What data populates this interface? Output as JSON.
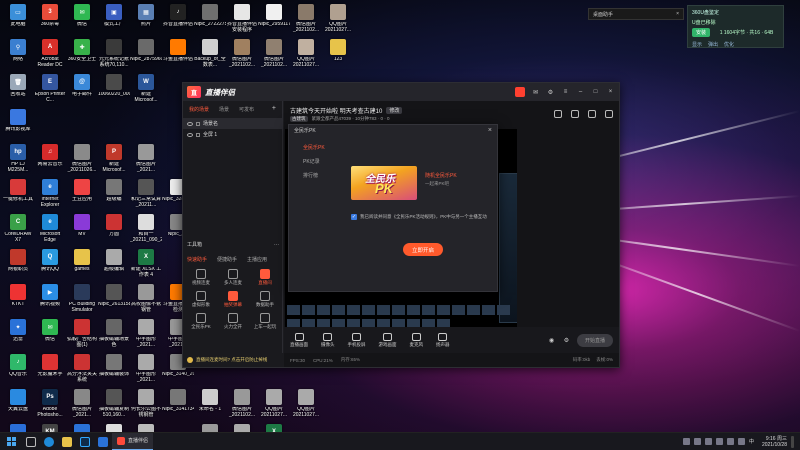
{
  "desktop_icons": [
    {
      "label": "此电脑",
      "color": "#3b8fd9",
      "glyph": "▭"
    },
    {
      "label": "360杀毒",
      "color": "#e94c3a",
      "glyph": "3"
    },
    {
      "label": "微信",
      "color": "#2fb852",
      "glyph": "✉"
    },
    {
      "label": "模式工厂",
      "color": "#3a5ec0",
      "glyph": "▣"
    },
    {
      "label": "照片",
      "color": "#5a7fb4",
      "glyph": "▦"
    },
    {
      "label": "抖音直播伴侣",
      "color": "#222",
      "glyph": "♪"
    },
    {
      "label": "Nipic_27222751_20210...",
      "color": "#6f6f6f",
      "glyph": ""
    },
    {
      "label": "抖音直播伴侣安装程序",
      "color": "#e6e6e6",
      "glyph": ""
    },
    {
      "label": "Nipic_29591172_20200...",
      "color": "#f0f0f0",
      "glyph": ""
    },
    {
      "label": "微信图片_2021102...",
      "color": "#8a7a6a",
      "glyph": ""
    },
    {
      "label": "QQ图片20211027...",
      "color": "#b0a090",
      "glyph": ""
    },
    {
      "label": "网络",
      "color": "#3b7fd0",
      "glyph": "⚲"
    },
    {
      "label": "Acrobat Reader DC",
      "color": "#d9302a",
      "glyph": "A"
    },
    {
      "label": "360安全卫士",
      "color": "#38b24a",
      "glyph": "✚"
    },
    {
      "label": "元元系统记账系统70,110...",
      "color": "#3a3a3a",
      "glyph": ""
    },
    {
      "label": "Nipic_28759601_20210...",
      "color": "#6a6a6a",
      "glyph": ""
    },
    {
      "label": "斗鱼直播伴侣",
      "color": "#ff7a00",
      "glyph": ""
    },
    {
      "label": "Backup_of_全数表...",
      "color": "#cfcfcf",
      "glyph": ""
    },
    {
      "label": "微信图片_2021102...",
      "color": "#a08060",
      "glyph": ""
    },
    {
      "label": "微信图片_2021102...",
      "color": "#908070",
      "glyph": ""
    },
    {
      "label": "QQ图片20211027...",
      "color": "#c0b0a0",
      "glyph": ""
    },
    {
      "label": "123",
      "color": "#e7c34a",
      "glyph": ""
    },
    {
      "label": "回收站",
      "color": "#9aa8b8",
      "glyph": "🗑"
    },
    {
      "label": "Epson Printer C...",
      "color": "#3456a0",
      "glyph": "E"
    },
    {
      "label": "电子邮件",
      "color": "#3a88d8",
      "glyph": "@"
    },
    {
      "label": "10060220_0005780884",
      "color": "#4a4a4a",
      "glyph": ""
    },
    {
      "label": "新建 Microsof...",
      "color": "#2b579a",
      "glyph": "W"
    },
    {
      "label": "",
      "color": "",
      "glyph": ""
    },
    {
      "label": "",
      "color": "",
      "glyph": ""
    },
    {
      "label": "",
      "color": "",
      "glyph": ""
    },
    {
      "label": "",
      "color": "",
      "glyph": ""
    },
    {
      "label": "",
      "color": "",
      "glyph": ""
    },
    {
      "label": "",
      "color": "",
      "glyph": ""
    },
    {
      "label": "腾讯影视库",
      "color": "#3a78e0",
      "glyph": ""
    },
    {
      "label": "",
      "color": "",
      "glyph": ""
    },
    {
      "label": "",
      "color": "",
      "glyph": ""
    },
    {
      "label": "",
      "color": "",
      "glyph": ""
    },
    {
      "label": "",
      "color": "",
      "glyph": ""
    },
    {
      "label": "",
      "color": "",
      "glyph": ""
    },
    {
      "label": "",
      "color": "",
      "glyph": ""
    },
    {
      "label": "",
      "color": "",
      "glyph": ""
    },
    {
      "label": "",
      "color": "",
      "glyph": ""
    },
    {
      "label": "",
      "color": "",
      "glyph": ""
    },
    {
      "label": "",
      "color": "",
      "glyph": ""
    },
    {
      "label": "HP LJ M225M...",
      "color": "#2a5ea8",
      "glyph": "hp"
    },
    {
      "label": "网易云音乐",
      "color": "#d62b2b",
      "glyph": "♫"
    },
    {
      "label": "微信图片_20211026...",
      "color": "#8a8a8a",
      "glyph": ""
    },
    {
      "label": "新建 Microsof...",
      "color": "#c0392b",
      "glyph": "P"
    },
    {
      "label": "微信图片_2021...",
      "color": "#999",
      "glyph": ""
    },
    {
      "label": "",
      "color": "",
      "glyph": ""
    },
    {
      "label": "",
      "color": "",
      "glyph": ""
    },
    {
      "label": "",
      "color": "",
      "glyph": ""
    },
    {
      "label": "",
      "color": "",
      "glyph": ""
    },
    {
      "label": "",
      "color": "",
      "glyph": ""
    },
    {
      "label": "",
      "color": "",
      "glyph": ""
    },
    {
      "label": "一键修机工具",
      "color": "#d83a3a",
      "glyph": ""
    },
    {
      "label": "Internet Explorer",
      "color": "#2f7fd8",
      "glyph": "e"
    },
    {
      "label": "土豆应用",
      "color": "#e44",
      "glyph": ""
    },
    {
      "label": "超级编",
      "color": "#777",
      "glyph": ""
    },
    {
      "label": "和记三常试算_20211...",
      "color": "#555",
      "glyph": ""
    },
    {
      "label": "Nipic_32846_202...",
      "color": "#eee",
      "glyph": ""
    },
    {
      "label": "",
      "color": "",
      "glyph": ""
    },
    {
      "label": "",
      "color": "",
      "glyph": ""
    },
    {
      "label": "",
      "color": "",
      "glyph": ""
    },
    {
      "label": "",
      "color": "",
      "glyph": ""
    },
    {
      "label": "",
      "color": "",
      "glyph": ""
    },
    {
      "label": "CorelDRAW X7",
      "color": "#3aa048",
      "glyph": "C"
    },
    {
      "label": "Microsoft Edge",
      "color": "#1f8ad8",
      "glyph": "e"
    },
    {
      "label": "MV",
      "color": "#8a3ad8",
      "glyph": ""
    },
    {
      "label": "方圆",
      "color": "#c33",
      "glyph": ""
    },
    {
      "label": "和目一_20211_090_20210...",
      "color": "#ddd",
      "glyph": ""
    },
    {
      "label": "Nipic_2...",
      "color": "#888",
      "glyph": ""
    },
    {
      "label": "",
      "color": "",
      "glyph": ""
    },
    {
      "label": "",
      "color": "",
      "glyph": ""
    },
    {
      "label": "",
      "color": "",
      "glyph": ""
    },
    {
      "label": "",
      "color": "",
      "glyph": ""
    },
    {
      "label": "",
      "color": "",
      "glyph": ""
    },
    {
      "label": "网银职员",
      "color": "#c0392b",
      "glyph": ""
    },
    {
      "label": "腾讯QQ",
      "color": "#2a9ae0",
      "glyph": "Q"
    },
    {
      "label": "games",
      "color": "#e7c34a",
      "glyph": ""
    },
    {
      "label": "超级编辑",
      "color": "#aaa",
      "glyph": ""
    },
    {
      "label": "新建 XLSX 工作表 4",
      "color": "#1d7a45",
      "glyph": "X"
    },
    {
      "label": "",
      "color": "",
      "glyph": ""
    },
    {
      "label": "",
      "color": "",
      "glyph": ""
    },
    {
      "label": "",
      "color": "",
      "glyph": ""
    },
    {
      "label": "",
      "color": "",
      "glyph": ""
    },
    {
      "label": "",
      "color": "",
      "glyph": ""
    },
    {
      "label": "",
      "color": "",
      "glyph": ""
    },
    {
      "label": "KTKT",
      "color": "#e33",
      "glyph": ""
    },
    {
      "label": "腾讯视频",
      "color": "#2b8ee6",
      "glyph": "▶"
    },
    {
      "label": "PC Building Simulator",
      "color": "#2a3a5a",
      "glyph": ""
    },
    {
      "label": "Nipic_26131580_20191...",
      "color": "#555",
      "glyph": ""
    },
    {
      "label": "高校图像不锈钢管",
      "color": "#999",
      "glyph": ""
    },
    {
      "label": "斗鱼直播安全检测",
      "color": "#ff7a00",
      "glyph": ""
    },
    {
      "label": "",
      "color": "",
      "glyph": ""
    },
    {
      "label": "",
      "color": "",
      "glyph": ""
    },
    {
      "label": "",
      "color": "",
      "glyph": ""
    },
    {
      "label": "",
      "color": "",
      "glyph": ""
    },
    {
      "label": "",
      "color": "",
      "glyph": ""
    },
    {
      "label": "迅雷",
      "color": "#2a72d8",
      "glyph": "✦"
    },
    {
      "label": "微信",
      "color": "#2fb852",
      "glyph": "✉"
    },
    {
      "label": "弘毅广告结构图(1)",
      "color": "#c33",
      "glyph": ""
    },
    {
      "label": "抽板磁辅场景色",
      "color": "#666",
      "glyph": ""
    },
    {
      "label": "中宇图形_2021...",
      "color": "#aaa",
      "glyph": ""
    },
    {
      "label": "中宇图形_2021...",
      "color": "#999",
      "glyph": ""
    },
    {
      "label": "",
      "color": "",
      "glyph": ""
    },
    {
      "label": "",
      "color": "",
      "glyph": ""
    },
    {
      "label": "",
      "color": "",
      "glyph": ""
    },
    {
      "label": "",
      "color": "",
      "glyph": ""
    },
    {
      "label": "",
      "color": "",
      "glyph": ""
    },
    {
      "label": "QQ音乐",
      "color": "#2fb86a",
      "glyph": "♪"
    },
    {
      "label": "光影魔术手",
      "color": "#d33",
      "glyph": ""
    },
    {
      "label": "高分浮法夹关系统",
      "color": "#c33",
      "glyph": ""
    },
    {
      "label": "抽板磁辅装饰",
      "color": "#777",
      "glyph": ""
    },
    {
      "label": "中宇图形_2021...",
      "color": "#aaa",
      "glyph": ""
    },
    {
      "label": "Nipic_3140_2021...",
      "color": "#888",
      "glyph": ""
    },
    {
      "label": "",
      "color": "",
      "glyph": ""
    },
    {
      "label": "",
      "color": "",
      "glyph": ""
    },
    {
      "label": "",
      "color": "",
      "glyph": ""
    },
    {
      "label": "",
      "color": "",
      "glyph": ""
    },
    {
      "label": "",
      "color": "",
      "glyph": ""
    },
    {
      "label": "天翼云盘",
      "color": "#2a8ae0",
      "glyph": ""
    },
    {
      "label": "Adobe Photosho...",
      "color": "#0f2b4a",
      "glyph": "Ps"
    },
    {
      "label": "微信图片_2021...",
      "color": "#888",
      "glyph": ""
    },
    {
      "label": "抽板磁辅复制 510,160...",
      "color": "#555",
      "glyph": ""
    },
    {
      "label": "何长尔公图不锈钢管",
      "color": "#aaa",
      "glyph": ""
    },
    {
      "label": "Nipic_31417340_20201...",
      "color": "#777",
      "glyph": ""
    },
    {
      "label": "未命名 - 1",
      "color": "#ccc",
      "glyph": ""
    },
    {
      "label": "微信图片_2021102...",
      "color": "#999",
      "glyph": ""
    },
    {
      "label": "QQ图片20211027...",
      "color": "#aaa",
      "glyph": ""
    },
    {
      "label": "QQ图片20211027...",
      "color": "#aaa",
      "glyph": ""
    },
    {
      "label": "",
      "color": "",
      "glyph": ""
    },
    {
      "label": "腾讯游戏助手",
      "color": "#2a6ed8",
      "glyph": ""
    },
    {
      "label": "KMPlayer 64X",
      "color": "#444",
      "glyph": "KM"
    },
    {
      "label": "迅雷下载",
      "color": "#2a72d8",
      "glyph": ""
    },
    {
      "label": "Nipic_32254332_20201...",
      "color": "#ddd",
      "glyph": ""
    },
    {
      "label": "Nipic_...",
      "color": "#bbb",
      "glyph": ""
    },
    {
      "label": "",
      "color": "",
      "glyph": ""
    },
    {
      "label": "微信图片_2021102...",
      "color": "#999",
      "glyph": ""
    },
    {
      "label": "QQ图片20211027...",
      "color": "#aaa",
      "glyph": ""
    },
    {
      "label": "图纸样板图",
      "color": "#1d7a45",
      "glyph": "X"
    },
    {
      "label": "",
      "color": "",
      "glyph": ""
    },
    {
      "label": "",
      "color": "",
      "glyph": ""
    }
  ],
  "minibox": {
    "label": "桌面助手",
    "close": "×"
  },
  "tray_popup": {
    "title": "360U盘鉴定",
    "line1": "U盘已移除",
    "badge": "安装",
    "info": "1 1604字节 · 共16 · 64B",
    "tabs": [
      "显示",
      "弹出",
      "优化"
    ]
  },
  "app": {
    "title": "直播伴侣",
    "logo_glyph": "直",
    "left_tabs": [
      "我的场景",
      "场景",
      "可发布"
    ],
    "left_tab_plus": "+",
    "scenes": [
      "场景名",
      "全屏 1"
    ],
    "tools_label": "工具箱",
    "tools_more": "···",
    "tools_tabs": [
      "快速助手",
      "便捷助手",
      "主播应用"
    ],
    "tools": [
      {
        "label": "视频连麦",
        "hot": false
      },
      {
        "label": "多人连麦",
        "hot": false
      },
      {
        "label": "直播间",
        "hot": true
      },
      {
        "label": "虚拟形象",
        "hot": false
      },
      {
        "label": "抽奖弹幕",
        "hot": true
      },
      {
        "label": "数据助手",
        "hot": false
      },
      {
        "label": "全民乐PK",
        "hot": false
      },
      {
        "label": "火力全开",
        "hot": false
      },
      {
        "label": "上车一起玩",
        "hot": false
      }
    ],
    "room_title": "古建筑今天开始啦 明天考查古建10",
    "room_tag": "修改",
    "room_sub": {
      "tag": "古建筑",
      "text": "紧跟全都产品47039 · 10分钟783 · 0 · 0"
    },
    "bottom_buttons": [
      "直播画面",
      "摄像头",
      "手机投屏",
      "游戏画面",
      "麦克风",
      "扬声器"
    ],
    "live_button": "开始直播",
    "status": {
      "fps": "FPS:30",
      "cpu": "CPU:21%",
      "mem": "内存:65%",
      "bitrate": "码率:0kb",
      "loss": "丢帧:0%"
    },
    "notice": "直播间连麦时间? 点击开启防止掉线"
  },
  "dialog": {
    "header": "全民乐PK",
    "close": "×",
    "side_items": [
      "全民乐PK",
      "PK记录",
      "排行榜"
    ],
    "banner_line1": "全民乐",
    "banner_line2": "PK",
    "promo_title": "随机全民乐PK",
    "promo_sub": "一起来PK吧",
    "agree_text": "我已阅读并同意《全民乐PK活动规则》，PK中与另一个主播互动",
    "open_button": "立即开启"
  },
  "taskbar": {
    "active_app": "直播伴侣",
    "time": "9:16",
    "weekday": "周三",
    "date": "2021/10/28",
    "tray_text": "中"
  }
}
